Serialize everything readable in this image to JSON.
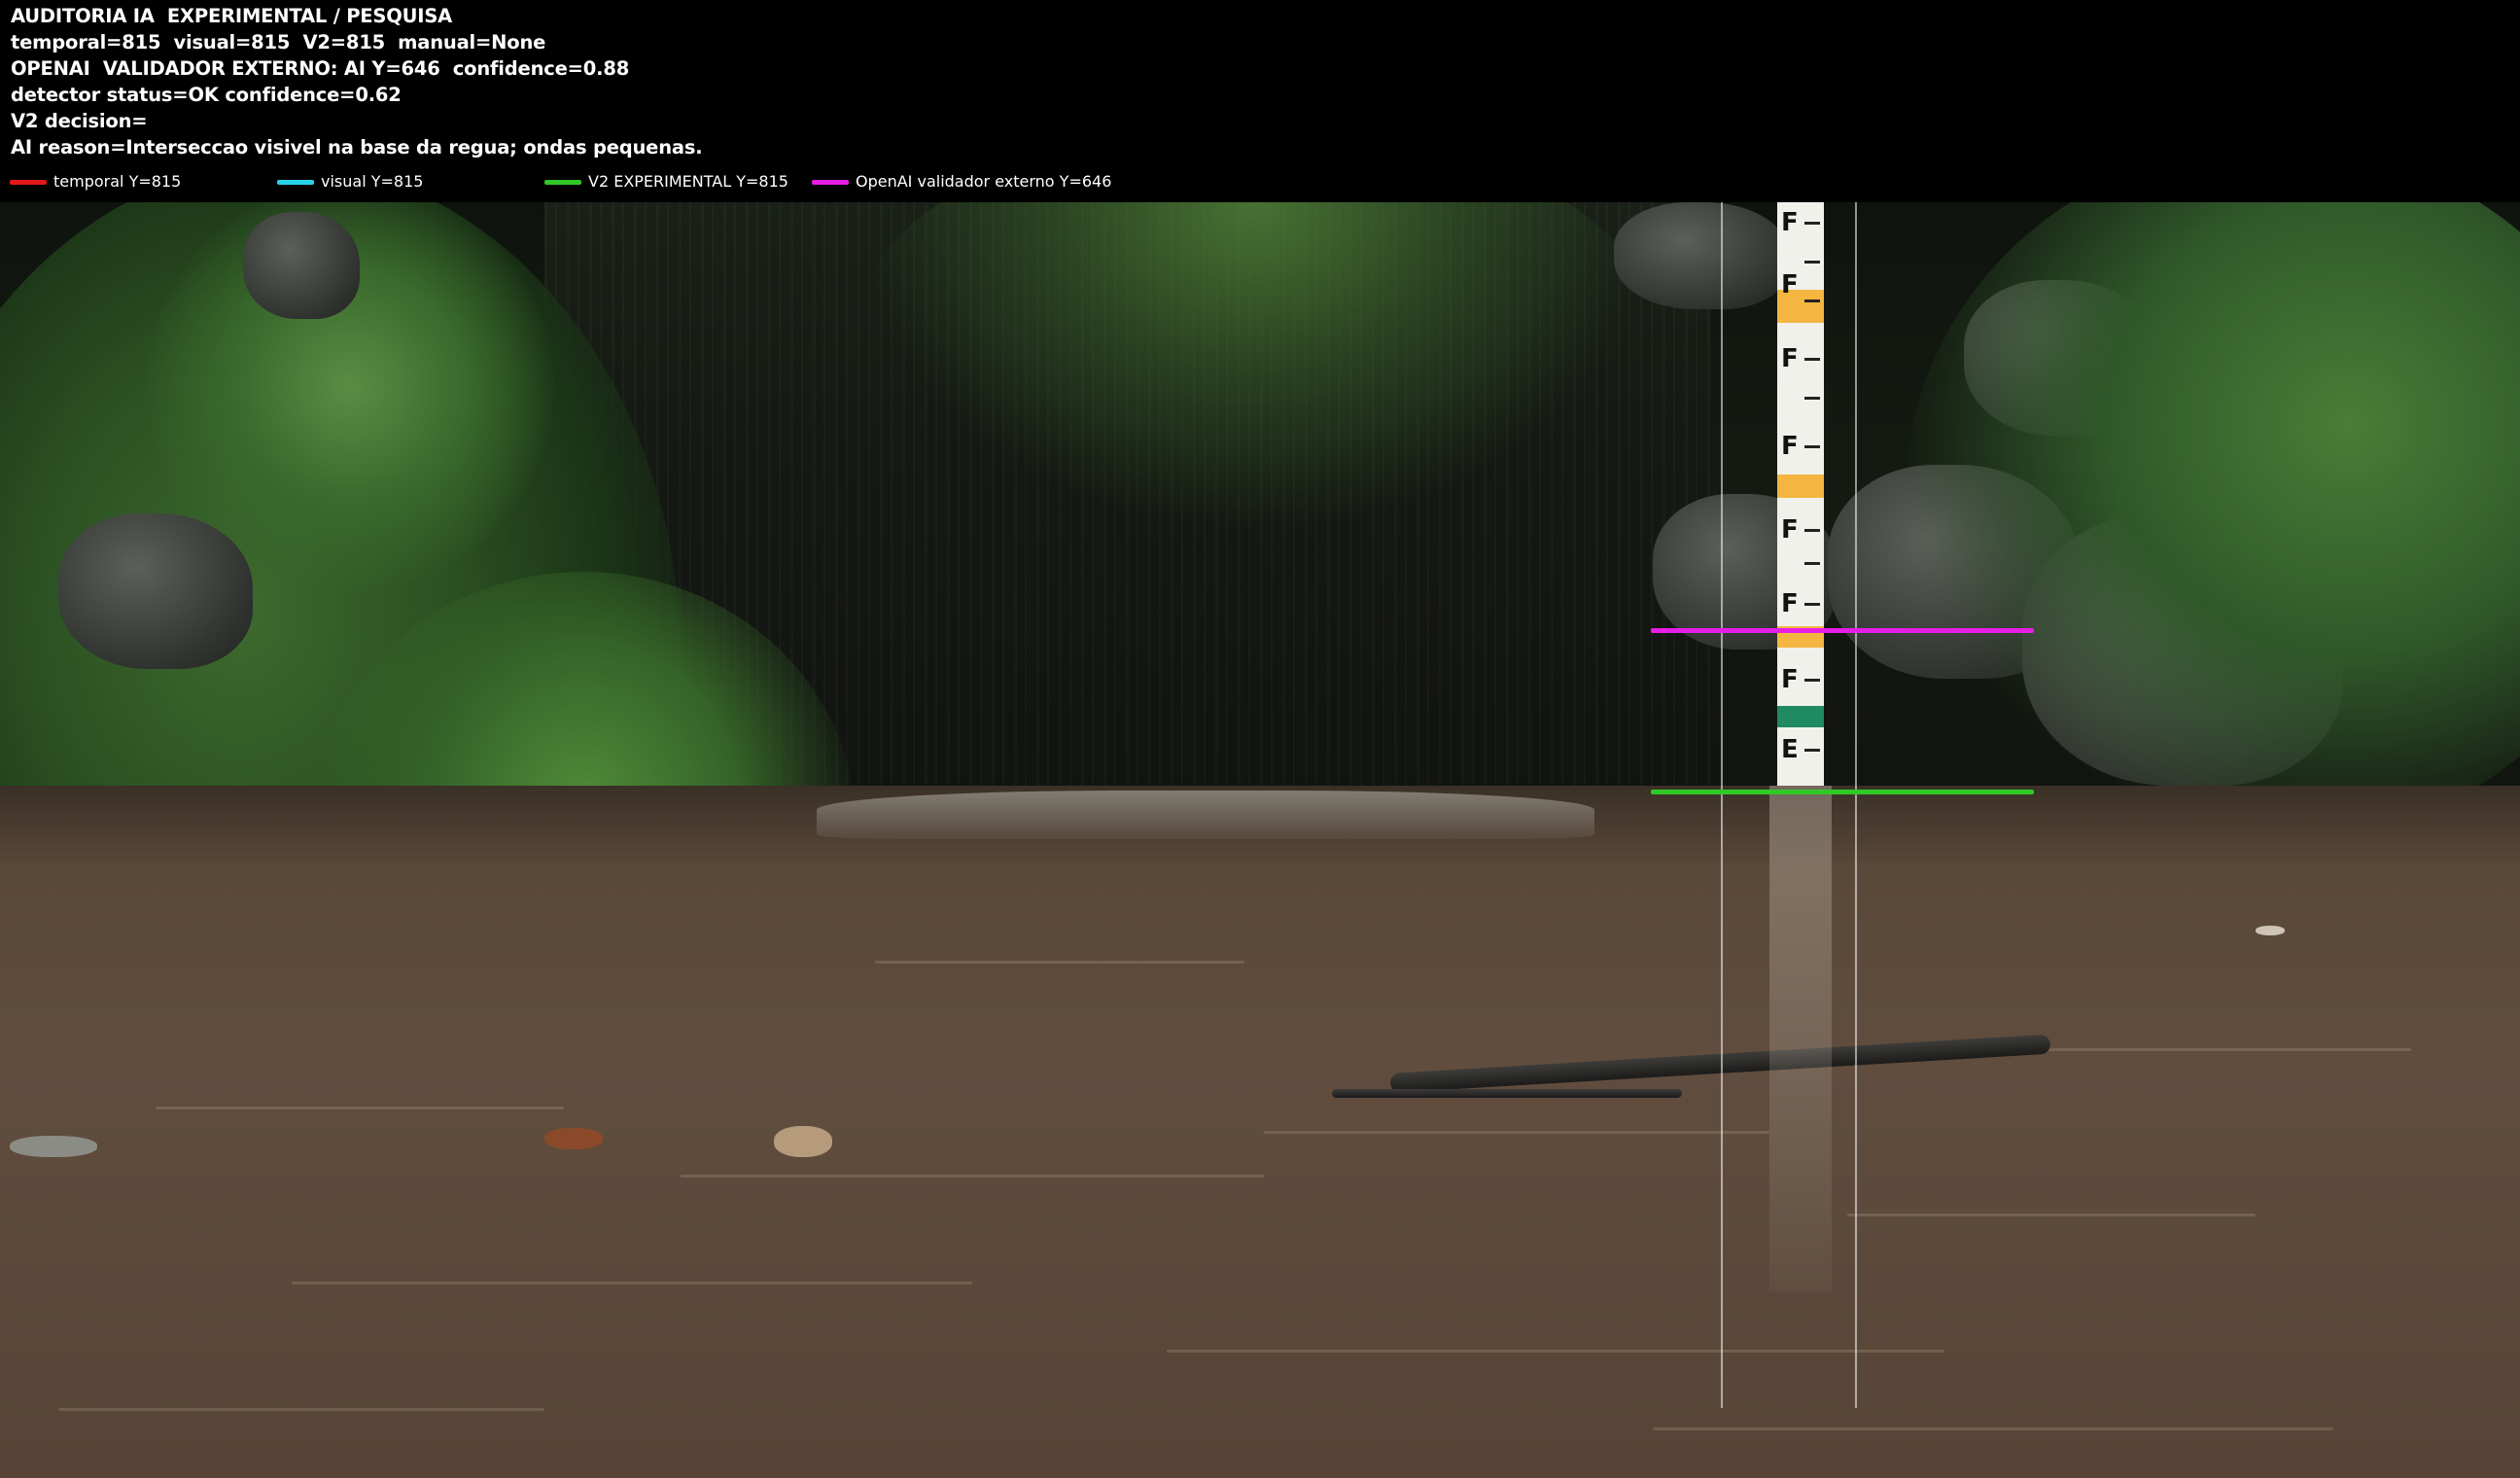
{
  "header": {
    "line1": "AUDITORIA IA  EXPERIMENTAL / PESQUISA",
    "line2": "temporal=815  visual=815  V2=815  manual=None",
    "line3": "OPENAI  VALIDADOR EXTERNO: AI Y=646  confidence=0.88",
    "line4": "detector status=OK confidence=0.62",
    "line5": "V2 decision=",
    "line6": "AI reason=Interseccao visivel na base da regua; ondas pequenas."
  },
  "legend": [
    {
      "label": "temporal Y=815",
      "color": "#e3181a"
    },
    {
      "label": "visual Y=815",
      "color": "#28d2e6"
    },
    {
      "label": "V2 EXPERIMENTAL Y=815",
      "color": "#32c828"
    },
    {
      "label": "OpenAI validador externo Y=646",
      "color": "#e61ee6"
    }
  ],
  "overlay": {
    "openai_line_color": "#e61ee6",
    "v2_line_color": "#32c828",
    "roi_color": "#ffffff"
  },
  "gauge": {
    "marks": [
      "F",
      "F",
      "F",
      "F",
      "F",
      "F",
      "F",
      "E"
    ]
  }
}
